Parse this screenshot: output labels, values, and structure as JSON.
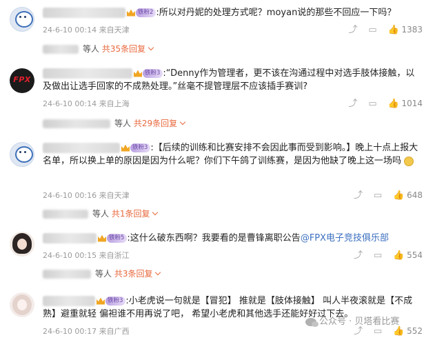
{
  "comments": [
    {
      "badge": "铁粉2",
      "text_parts": [
        ":所以对丹妮的处理方式呢？moyan说的那些不回应一下吗？"
      ],
      "time": "24-6-10 00:14",
      "location": "来自天津",
      "likes": "1383",
      "reply_suffix": "等人",
      "reply_link": "共35条回复"
    },
    {
      "badge": "铁粉3",
      "text_parts": [
        ":“Denny作为管理者，更不该在沟通过程中对选手肢体接触，以及做出让选手回家的不成熟处理。”丝毫不提管理层不应该插手赛训?"
      ],
      "time": "24-6-10 00:14",
      "location": "来自上海",
      "likes": "1014",
      "reply_suffix": "等人",
      "reply_link": "共29条回复"
    },
    {
      "badge": "铁粉3",
      "text_parts": [
        ":【后续的训练和比赛安排不会因此事而受到影响。】晚上十点上报大名单，所以换上单的原因是因为什么呢？你们下午鸽了训练赛，是因为他缺了晚上这一场吗"
      ],
      "time": "24-6-10 00:16",
      "location": "来自天津",
      "likes": "648",
      "reply_suffix": "等人",
      "reply_link": "共1条回复"
    },
    {
      "badge": "铁粉5",
      "text_before": ":这什么破东西啊？我要看的是曹锋离职公告",
      "link_text": "@FPX电子竞技俱乐部",
      "time": "24-6-10 00:15",
      "location": "来自浙江",
      "likes": "554",
      "reply_suffix": "等人",
      "reply_link": "共3条回复"
    },
    {
      "badge": "铁粉3",
      "text_parts": [
        ":小老虎说一句就是【冒犯】 推就是【肢体接触】 叫人半夜滚就是【不成熟】避重就轻 偏袒谁不用再说了吧， 希望小老虎和其他选手还能好好过下去。"
      ],
      "time": "24-6-10 00:17",
      "location": "来自广西",
      "likes": "552"
    }
  ],
  "actions": {
    "share_icon": "share-icon",
    "comment_icon": "comment-icon",
    "like_icon": "thumb-up-icon"
  },
  "watermark": "公众号 · 贝塔看比赛"
}
